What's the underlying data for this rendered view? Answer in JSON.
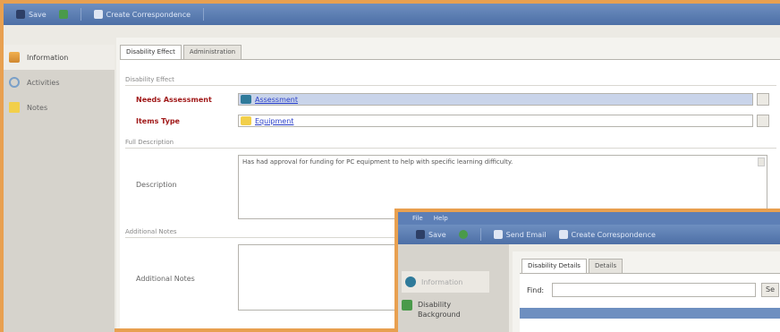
{
  "main": {
    "toolbar": {
      "save_label": "Save",
      "create_correspondence_label": "Create Correspondence"
    },
    "sidebar": {
      "items": [
        {
          "label": "Information"
        },
        {
          "label": "Activities"
        },
        {
          "label": "Notes"
        }
      ]
    },
    "tabs": [
      {
        "label": "Disability Effect"
      },
      {
        "label": "Administration"
      }
    ],
    "form": {
      "section_disability_effect": "Disability Effect",
      "needs_assessment_label": "Needs Assessment",
      "needs_assessment_value": "Assessment",
      "items_type_label": "Items Type",
      "items_type_value": "Equipment",
      "section_full_description": "Full Description",
      "description_label": "Description",
      "description_value": "Has had approval for funding for PC equipment to help with specific learning difficulty.",
      "section_additional_notes": "Additional Notes",
      "additional_notes_label": "Additional Notes",
      "additional_notes_value": ""
    }
  },
  "overlay": {
    "menu": [
      "File",
      "Help"
    ],
    "toolbar": {
      "save_label": "Save",
      "send_email_label": "Send Email",
      "create_correspondence_label": "Create Correspondence"
    },
    "sidebar": {
      "items": [
        {
          "label": "Information"
        },
        {
          "label": "Disability Background"
        }
      ]
    },
    "tabs": [
      {
        "label": "Disability Details"
      },
      {
        "label": "Details"
      }
    ],
    "find_label": "Find:",
    "find_value": "",
    "find_button_label": "Se"
  },
  "colors": {
    "frame_border": "#e8a050",
    "toolbar": "#5d7fb6",
    "link": "#2a3fc9",
    "required_label": "#a01818",
    "highlight_row": "#c9d4ea"
  }
}
